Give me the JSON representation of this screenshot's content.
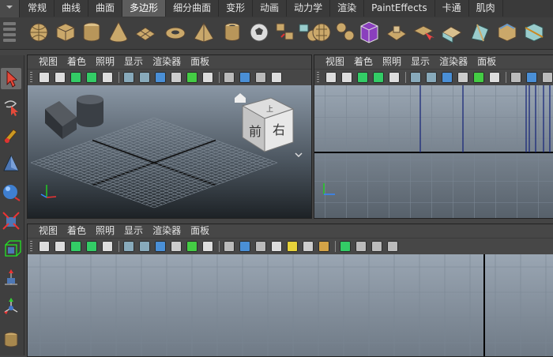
{
  "tabs": [
    "常规",
    "曲线",
    "曲面",
    "多边形",
    "细分曲面",
    "变形",
    "动画",
    "动力学",
    "渲染",
    "PaintEffects",
    "卡通",
    "肌肉"
  ],
  "active_tab": "多边形",
  "shelf_icons": [
    "poly-sphere-icon",
    "poly-cube-icon",
    "poly-cylinder-icon",
    "poly-cone-icon",
    "poly-plane-icon",
    "poly-torus-icon",
    "poly-pyramid-icon",
    "poly-pipe-icon",
    "soccer-ball-icon",
    "combine-icon",
    "separate-icon",
    "smooth-icon",
    "extract-icon",
    "boolean-icon",
    "extrude-icon",
    "bridge-icon",
    "append-icon",
    "wedge-icon",
    "bevel-icon",
    "split-icon"
  ],
  "panel_menu": [
    "视图",
    "着色",
    "照明",
    "显示",
    "渲染器",
    "面板"
  ],
  "viewcube": {
    "front": "前",
    "right": "右",
    "top": "上"
  },
  "colors": {
    "accent_red": "#d23b2b",
    "viewport_top": "#8a97a5",
    "viewport_bottom": "#1d2226",
    "grid_line": "#7a8693"
  }
}
